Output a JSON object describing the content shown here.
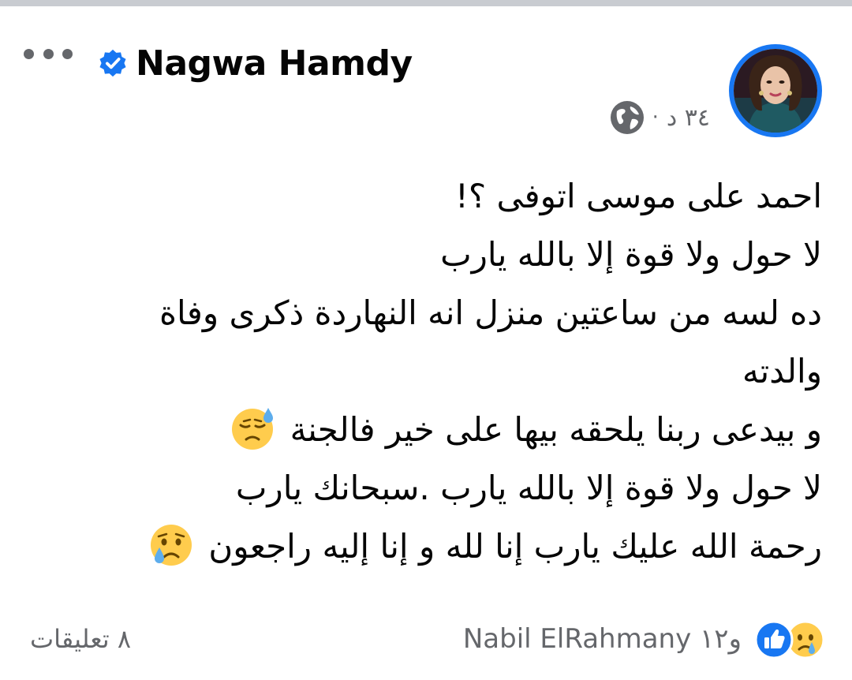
{
  "post": {
    "author": "Nagwa Hamdy",
    "timestamp": "٣٤ د",
    "separator": "·",
    "privacy_icon": "globe-icon",
    "verified_icon": "verified-badge-icon",
    "more_icon": "more-horizontal-icon",
    "lines": [
      "احمد على موسى اتوفى ؟!",
      "لا حول ولا قوة إلا بالله يارب",
      "ده لسه من ساعتين منزل انه النهاردة ذكرى وفاة",
      "والدته",
      "و بيدعى ربنا يلحقه بيها على خير فالجنة",
      "لا حول ولا قوة إلا بالله يارب .سبحانك يارب",
      "رحمة الله عليك يارب إنا لله و إنا إليه راجعون"
    ],
    "emojis": {
      "line5": "downcast-face-with-sweat-emoji",
      "line7": "crying-face-emoji"
    }
  },
  "reactions": {
    "text": "Nabil ElRahmany و١٢",
    "icons": [
      "sad-reaction-icon",
      "like-reaction-icon"
    ]
  },
  "comments": {
    "label": "٨ تعليقات"
  },
  "colors": {
    "accent": "#1877f2",
    "secondary_text": "#65676b",
    "primary_text": "#050505",
    "emoji_yellow": "#ffcc4d"
  }
}
